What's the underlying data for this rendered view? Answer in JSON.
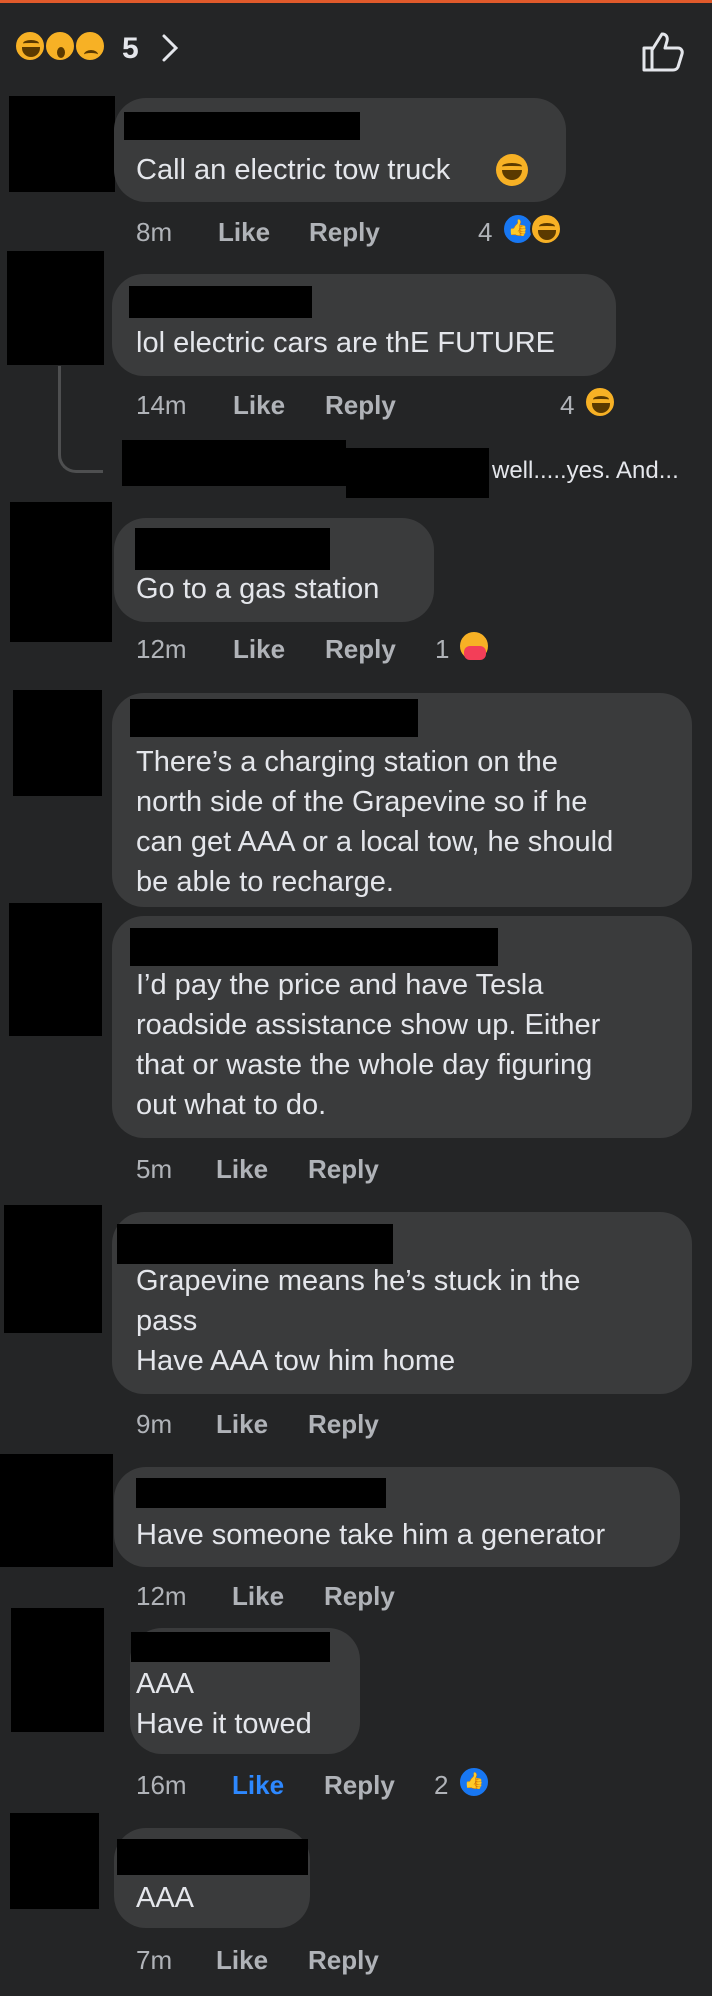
{
  "header": {
    "reaction_count": "5",
    "reactions": [
      "haha",
      "wow",
      "sad"
    ]
  },
  "comments": [
    {
      "text": "Call an electric tow truck",
      "time": "8m",
      "like": "Like",
      "reply": "Reply",
      "reaction_count": "4"
    },
    {
      "text": "lol electric cars are thE FUTURE",
      "time": "14m",
      "like": "Like",
      "reply": "Reply",
      "reaction_count": "4",
      "reply_preview": "well.....yes.  And..."
    },
    {
      "text": "Go to a gas station",
      "time": "12m",
      "like": "Like",
      "reply": "Reply",
      "reaction_count": "1"
    },
    {
      "text": "There’s a charging station on the\nnorth side of the Grapevine so if he\ncan get AAA or a local tow, he should\nbe able to recharge."
    },
    {
      "text": "I’d pay the price and have Tesla\nroadside assistance show up. Either\nthat or waste the whole day figuring\nout what to do.",
      "time": "5m",
      "like": "Like",
      "reply": "Reply"
    },
    {
      "text": "Grapevine means he’s stuck in the\npass\nHave AAA tow him home",
      "time": "9m",
      "like": "Like",
      "reply": "Reply"
    },
    {
      "text": "Have someone take him a generator",
      "time": "12m",
      "like": "Like",
      "reply": "Reply"
    },
    {
      "text": "AAA\nHave it towed",
      "time": "16m",
      "like": "Like",
      "reply": "Reply",
      "reaction_count": "2"
    },
    {
      "text": "AAA",
      "time": "7m",
      "like": "Like",
      "reply": "Reply"
    }
  ],
  "colors": {
    "accent": "#2d88ff",
    "bubble": "#3a3b3c",
    "background": "#242526"
  },
  "icons": [
    "chevron-right-icon",
    "thumbs-up-icon"
  ]
}
